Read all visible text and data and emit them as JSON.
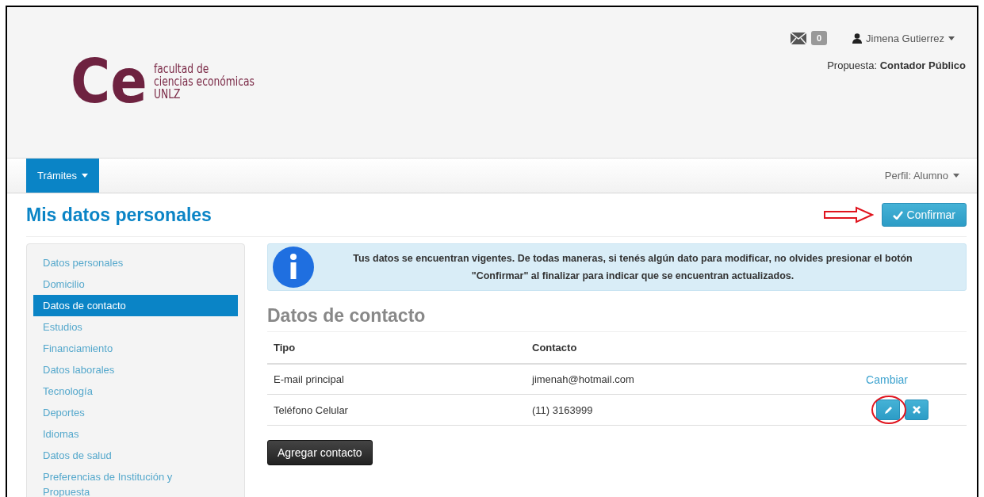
{
  "header": {
    "logo": {
      "mark": "Ce",
      "lines": [
        "facultad de",
        "ciencias económicas",
        "UNLZ"
      ]
    },
    "messages": {
      "count": "0"
    },
    "user": {
      "name": "Jimena Gutierrez"
    },
    "proposal": {
      "label": "Propuesta:",
      "value": "Contador Público"
    }
  },
  "navbar": {
    "menus": [
      {
        "label": "Trámites",
        "selected": true
      }
    ],
    "profile": "Perfil: Alumno"
  },
  "page": {
    "title": "Mis datos personales",
    "confirm_button": "Confirmar"
  },
  "sidebar": {
    "items": [
      {
        "label": "Datos personales",
        "selected": false
      },
      {
        "label": "Domicilio",
        "selected": false
      },
      {
        "label": "Datos de contacto",
        "selected": true
      },
      {
        "label": "Estudios",
        "selected": false
      },
      {
        "label": "Financiamiento",
        "selected": false
      },
      {
        "label": "Datos laborales",
        "selected": false
      },
      {
        "label": "Tecnología",
        "selected": false
      },
      {
        "label": "Deportes",
        "selected": false
      },
      {
        "label": "Idiomas",
        "selected": false
      },
      {
        "label": "Datos de salud",
        "selected": false
      },
      {
        "label": "Preferencias de Institución y Propuesta",
        "selected": false
      }
    ]
  },
  "alert": {
    "text": "Tus datos se encuentran vigentes. De todas maneras, si tenés algún dato para modificar, no olvides presionar el botón \"Confirmar\" al finalizar para indicar que se encuentran actualizados."
  },
  "section": {
    "title": "Datos de contacto"
  },
  "table": {
    "columns": [
      "Tipo",
      "Contacto"
    ],
    "rows": [
      {
        "tipo": "E-mail principal",
        "contacto": "jimenah@hotmail.com",
        "actions": {
          "kind": "link",
          "label": "Cambiar"
        }
      },
      {
        "tipo": "Teléfono Celular",
        "contacto": "(11) 3163999",
        "actions": {
          "kind": "icons"
        }
      }
    ]
  },
  "add_button": "Agregar contacto"
}
